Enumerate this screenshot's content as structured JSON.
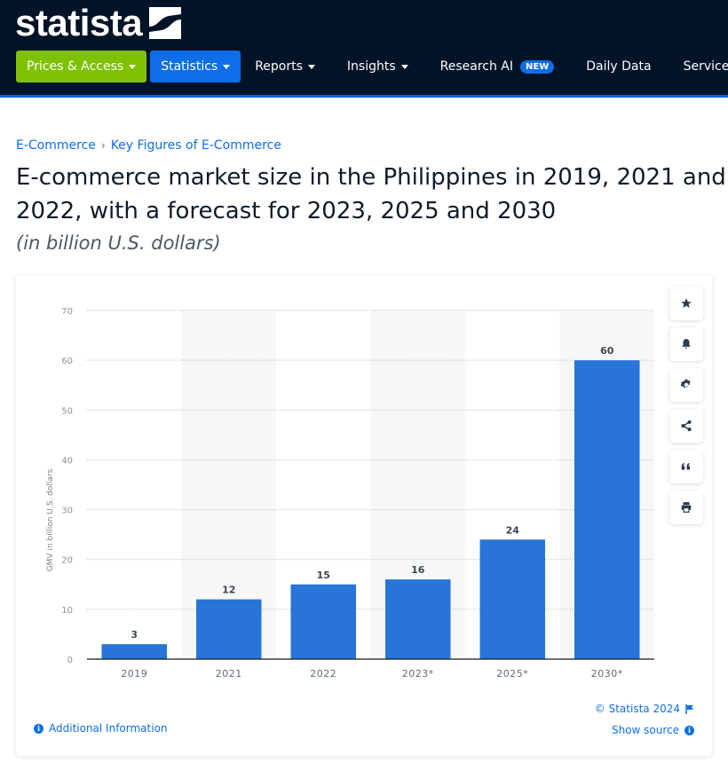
{
  "header": {
    "logo_text": "statista",
    "nav": [
      {
        "label": "Prices & Access",
        "caret": true,
        "style": "green"
      },
      {
        "label": "Statistics",
        "caret": true,
        "style": "blue"
      },
      {
        "label": "Reports",
        "caret": true,
        "style": "plain"
      },
      {
        "label": "Insights",
        "caret": true,
        "style": "plain"
      },
      {
        "label": "Research AI",
        "caret": false,
        "style": "plain",
        "badge": "NEW"
      },
      {
        "label": "Daily Data",
        "caret": false,
        "style": "plain"
      },
      {
        "label": "Services",
        "caret": true,
        "style": "plain"
      }
    ]
  },
  "breadcrumb": {
    "items": [
      "E-Commerce",
      "Key Figures of E-Commerce"
    ],
    "separator": "›"
  },
  "page": {
    "title": "E-commerce market size in the Philippines in 2019, 2021 and 2022, with a forecast for 2023, 2025 and 2030",
    "subtitle": "(in billion U.S. dollars)"
  },
  "tools": [
    {
      "name": "star-icon"
    },
    {
      "name": "bell-icon"
    },
    {
      "name": "gear-icon"
    },
    {
      "name": "share-icon"
    },
    {
      "name": "quote-icon"
    },
    {
      "name": "print-icon"
    }
  ],
  "footer": {
    "additional_info": "Additional Information",
    "copyright": "© Statista 2024",
    "show_source": "Show source",
    "info_glyph": "i"
  },
  "colors": {
    "bar": "#2874d8",
    "accent": "#0d6ee8",
    "header_bg": "#001327",
    "green": "#7ec100"
  },
  "chart_data": {
    "type": "bar",
    "title": "E-commerce market size in the Philippines in 2019, 2021 and 2022, with a forecast for 2023, 2025 and 2030",
    "categories": [
      "2019",
      "2021",
      "2022",
      "2023*",
      "2025*",
      "2030*"
    ],
    "values": [
      3,
      12,
      15,
      16,
      24,
      60
    ],
    "data_labels": [
      "3",
      "12",
      "15",
      "16",
      "24",
      "60"
    ],
    "xlabel": "",
    "ylabel": "GMV in billion U.S. dollars",
    "ylim": [
      0,
      70
    ],
    "yticks": [
      0,
      10,
      20,
      30,
      40,
      50,
      60,
      70
    ],
    "grid": true,
    "legend": "none"
  }
}
